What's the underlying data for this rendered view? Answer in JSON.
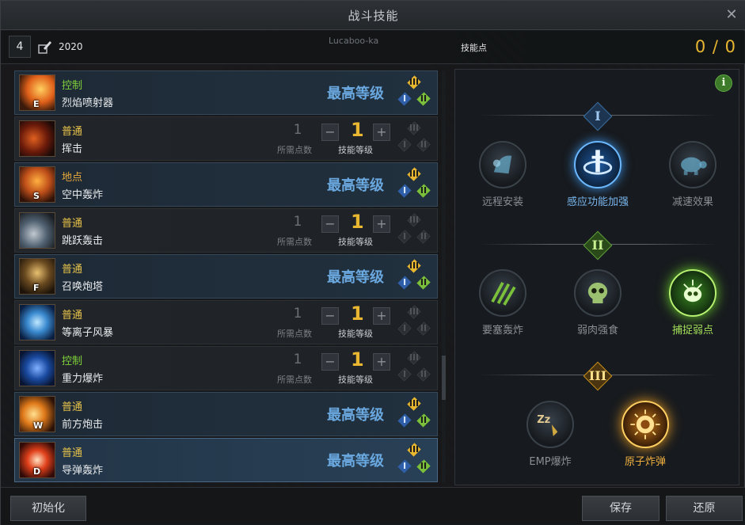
{
  "window": {
    "title": "战斗技能",
    "close": "✕"
  },
  "info": {
    "level": "4",
    "score": "2020",
    "player_name": "Lucaboo-ka",
    "skill_points_label": "技能点",
    "skill_points_value": "0 / 0"
  },
  "labels": {
    "max_level": "最高等级",
    "required_points": "所需点数",
    "skill_level": "技能等级",
    "minus": "−",
    "plus": "+"
  },
  "skills": [
    {
      "type": "控制",
      "type_color": "green",
      "name": "烈焰喷射器",
      "key": "E",
      "state": "max"
    },
    {
      "type": "普通",
      "type_color": "yellow",
      "name": "挥击",
      "key": "",
      "state": "level",
      "required": "1",
      "level": "1"
    },
    {
      "type": "地点",
      "type_color": "orange",
      "name": "空中轰炸",
      "key": "S",
      "state": "max"
    },
    {
      "type": "普通",
      "type_color": "yellow",
      "name": "跳跃轰击",
      "key": "",
      "state": "level",
      "required": "1",
      "level": "1"
    },
    {
      "type": "普通",
      "type_color": "yellow",
      "name": "召唤炮塔",
      "key": "F",
      "state": "max"
    },
    {
      "type": "普通",
      "type_color": "yellow",
      "name": "等离子风暴",
      "key": "",
      "state": "level",
      "required": "1",
      "level": "1"
    },
    {
      "type": "控制",
      "type_color": "green",
      "name": "重力爆炸",
      "key": "",
      "state": "level",
      "required": "1",
      "level": "1"
    },
    {
      "type": "普通",
      "type_color": "yellow",
      "name": "前方炮击",
      "key": "W",
      "state": "max"
    },
    {
      "type": "普通",
      "type_color": "yellow",
      "name": "导弹轰炸",
      "key": "D",
      "state": "max",
      "selected": true
    }
  ],
  "tiers": {
    "t1": "I",
    "t2": "II",
    "t3": "III"
  },
  "tree": {
    "info": "i",
    "tier1": [
      {
        "name": "远程安装",
        "active": ""
      },
      {
        "name": "感应功能加强",
        "active": "blue"
      },
      {
        "name": "减速效果",
        "active": ""
      }
    ],
    "tier2": [
      {
        "name": "要塞轰炸",
        "active": ""
      },
      {
        "name": "弱肉强食",
        "active": ""
      },
      {
        "name": "捕捉弱点",
        "active": "green"
      }
    ],
    "tier3": [
      {
        "name": "EMP爆炸",
        "active": ""
      },
      {
        "name": "原子炸弹",
        "active": "gold"
      }
    ]
  },
  "buttons": {
    "reset": "初始化",
    "save": "保存",
    "restore": "还原"
  }
}
